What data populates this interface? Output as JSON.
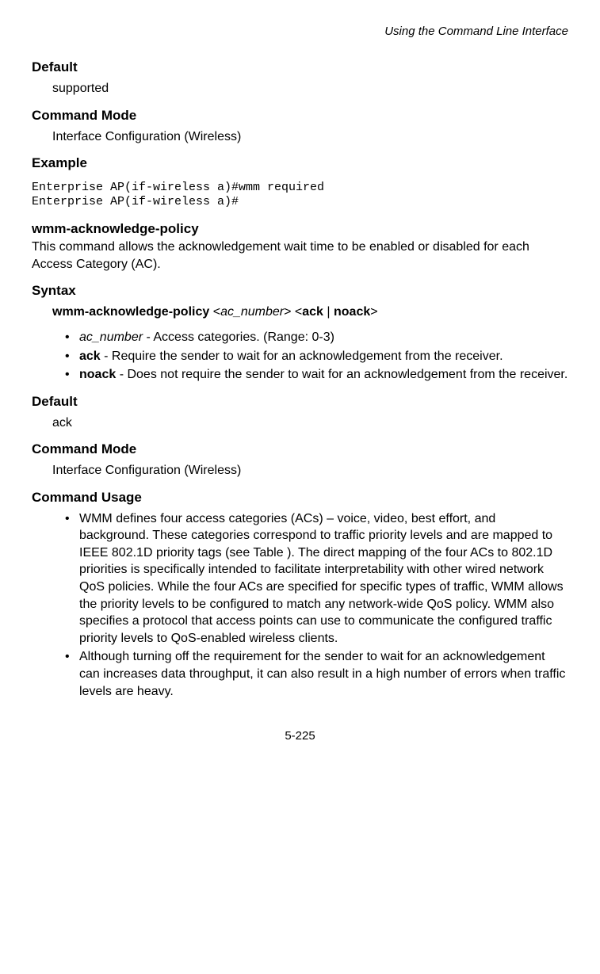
{
  "header": {
    "right": "Using the Command Line Interface"
  },
  "sec1": {
    "default_head": "Default",
    "default_val": "supported",
    "cmdmode_head": "Command Mode",
    "cmdmode_val": "Interface Configuration (Wireless)",
    "example_head": "Example",
    "code": "Enterprise AP(if-wireless a)#wmm required\nEnterprise AP(if-wireless a)#"
  },
  "cmd2": {
    "title": "wmm-acknowledge-policy",
    "desc": "This command allows the acknowledgement wait time to be enabled or disabled for each Access Category (AC).",
    "syntax_head": "Syntax",
    "syntax_cmd": "wmm-acknowledge-policy",
    "syntax_arg1": "ac_number",
    "syntax_arg2": "ack",
    "syntax_arg3": "noack",
    "params": [
      {
        "term_italic": "ac_number",
        "rest": " - Access categories. (Range: 0-3)"
      },
      {
        "term_bold": "ack",
        "rest": " - Require the sender to wait for an acknowledgement from the receiver."
      },
      {
        "term_bold": "noack",
        "rest": " - Does not require the sender to wait for an acknowledgement from the receiver."
      }
    ],
    "default_head": "Default",
    "default_val": "ack",
    "cmdmode_head": "Command Mode",
    "cmdmode_val": "Interface Configuration (Wireless)",
    "usage_head": "Command Usage",
    "usage": [
      "WMM defines four access categories (ACs) – voice, video, best effort, and background. These categories correspond to traffic priority levels and are mapped to IEEE 802.1D priority tags (see Table ). The direct mapping of the four ACs to 802.1D priorities is specifically intended to facilitate interpretability with other wired network QoS policies. While the four ACs are specified for specific types of traffic, WMM allows the priority levels to be configured to match any network-wide QoS policy. WMM also specifies a protocol that access points can use to communicate the configured traffic priority levels to QoS-enabled wireless clients.",
      "Although turning off the requirement for the sender to wait for an acknowledgement can increases data throughput, it can also result in a high number of errors when traffic levels are heavy."
    ]
  },
  "footer": {
    "page": "5-225"
  }
}
